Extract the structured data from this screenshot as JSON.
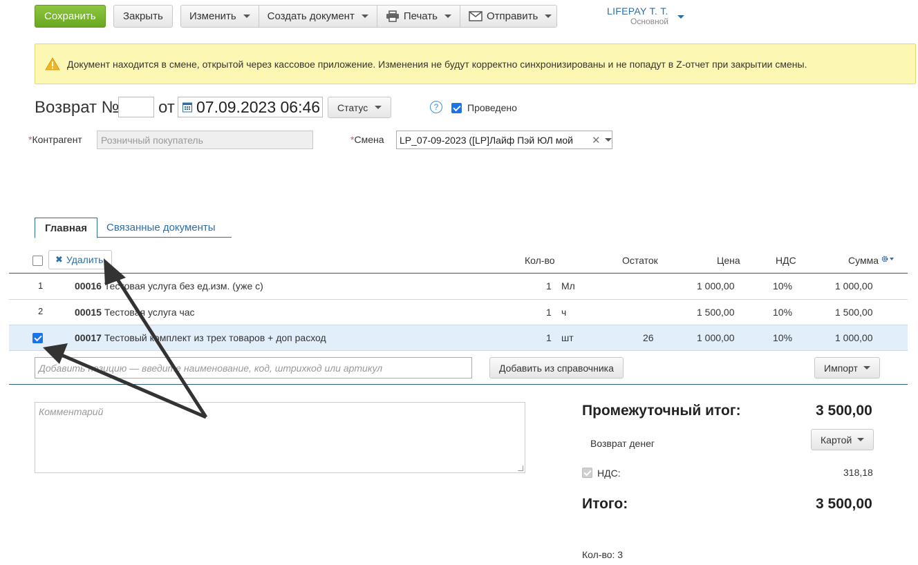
{
  "toolbar": {
    "save": "Сохранить",
    "close": "Закрыть",
    "edit": "Изменить",
    "create_doc": "Создать документ",
    "print": "Печать",
    "send": "Отправить"
  },
  "user": {
    "name": "LIFEPAY Т. Т.",
    "role": "Основной"
  },
  "warning": {
    "text": "Документ находится в смене, открытой через кассовое приложение. Изменения не будут корректно синхронизированы и не попадут в Z-отчет при закрытии смены."
  },
  "header": {
    "title": "Возврат №",
    "number": "",
    "from": "от",
    "date": "07.09.2023 06:46",
    "status": "Статус",
    "help": "?",
    "posted_label": "Проведено",
    "posted_checked": true
  },
  "fields": {
    "counterparty_label": "Контрагент",
    "counterparty_placeholder": "Розничный покупатель",
    "shift_label": "Смена",
    "shift_value": "LP_07-09-2023 ([LP]Лайф Пэй ЮЛ мой"
  },
  "tabs": {
    "main": "Главная",
    "related": "Связанные документы"
  },
  "table": {
    "delete": "Удалить",
    "columns": {
      "qty": "Кол-во",
      "stock": "Остаток",
      "price": "Цена",
      "vat": "НДС",
      "sum": "Сумма"
    },
    "rows": [
      {
        "num": "1",
        "code": "00016",
        "name": "Тестовая услуга без ед.изм. (уже с)",
        "qty": "1",
        "unit": "Мл",
        "stock": "",
        "price": "1 000,00",
        "vat": "10%",
        "sum": "1 000,00",
        "checked": false
      },
      {
        "num": "2",
        "code": "00015",
        "name": "Тестовая услуга час",
        "qty": "1",
        "unit": "ч",
        "stock": "",
        "price": "1 500,00",
        "vat": "10%",
        "sum": "1 500,00",
        "checked": false
      },
      {
        "num": "",
        "code": "00017",
        "name": "Тестовый комплект из трех товаров + доп расход",
        "qty": "1",
        "unit": "шт",
        "stock": "26",
        "price": "1 000,00",
        "vat": "10%",
        "sum": "1 000,00",
        "checked": true
      }
    ],
    "add_placeholder": "Добавить позицию — введите наименование, код, штрихкод или артикул",
    "add_from_catalog": "Добавить из справочника",
    "import": "Импорт"
  },
  "comment_placeholder": "Комментарий",
  "totals": {
    "subtotal_label": "Промежуточный итог:",
    "subtotal_value": "3 500,00",
    "refund_label": "Возврат денег",
    "refund_method": "Картой",
    "vat_label": "НДС:",
    "vat_value": "318,18",
    "total_label": "Итого:",
    "total_value": "3 500,00",
    "count_label": "Кол-во: 3"
  },
  "colors": {
    "accent": "#2e6da4",
    "save_green": "#78b72c",
    "warning_bg": "#fcf8b4",
    "selected_row": "#e2eef9"
  }
}
